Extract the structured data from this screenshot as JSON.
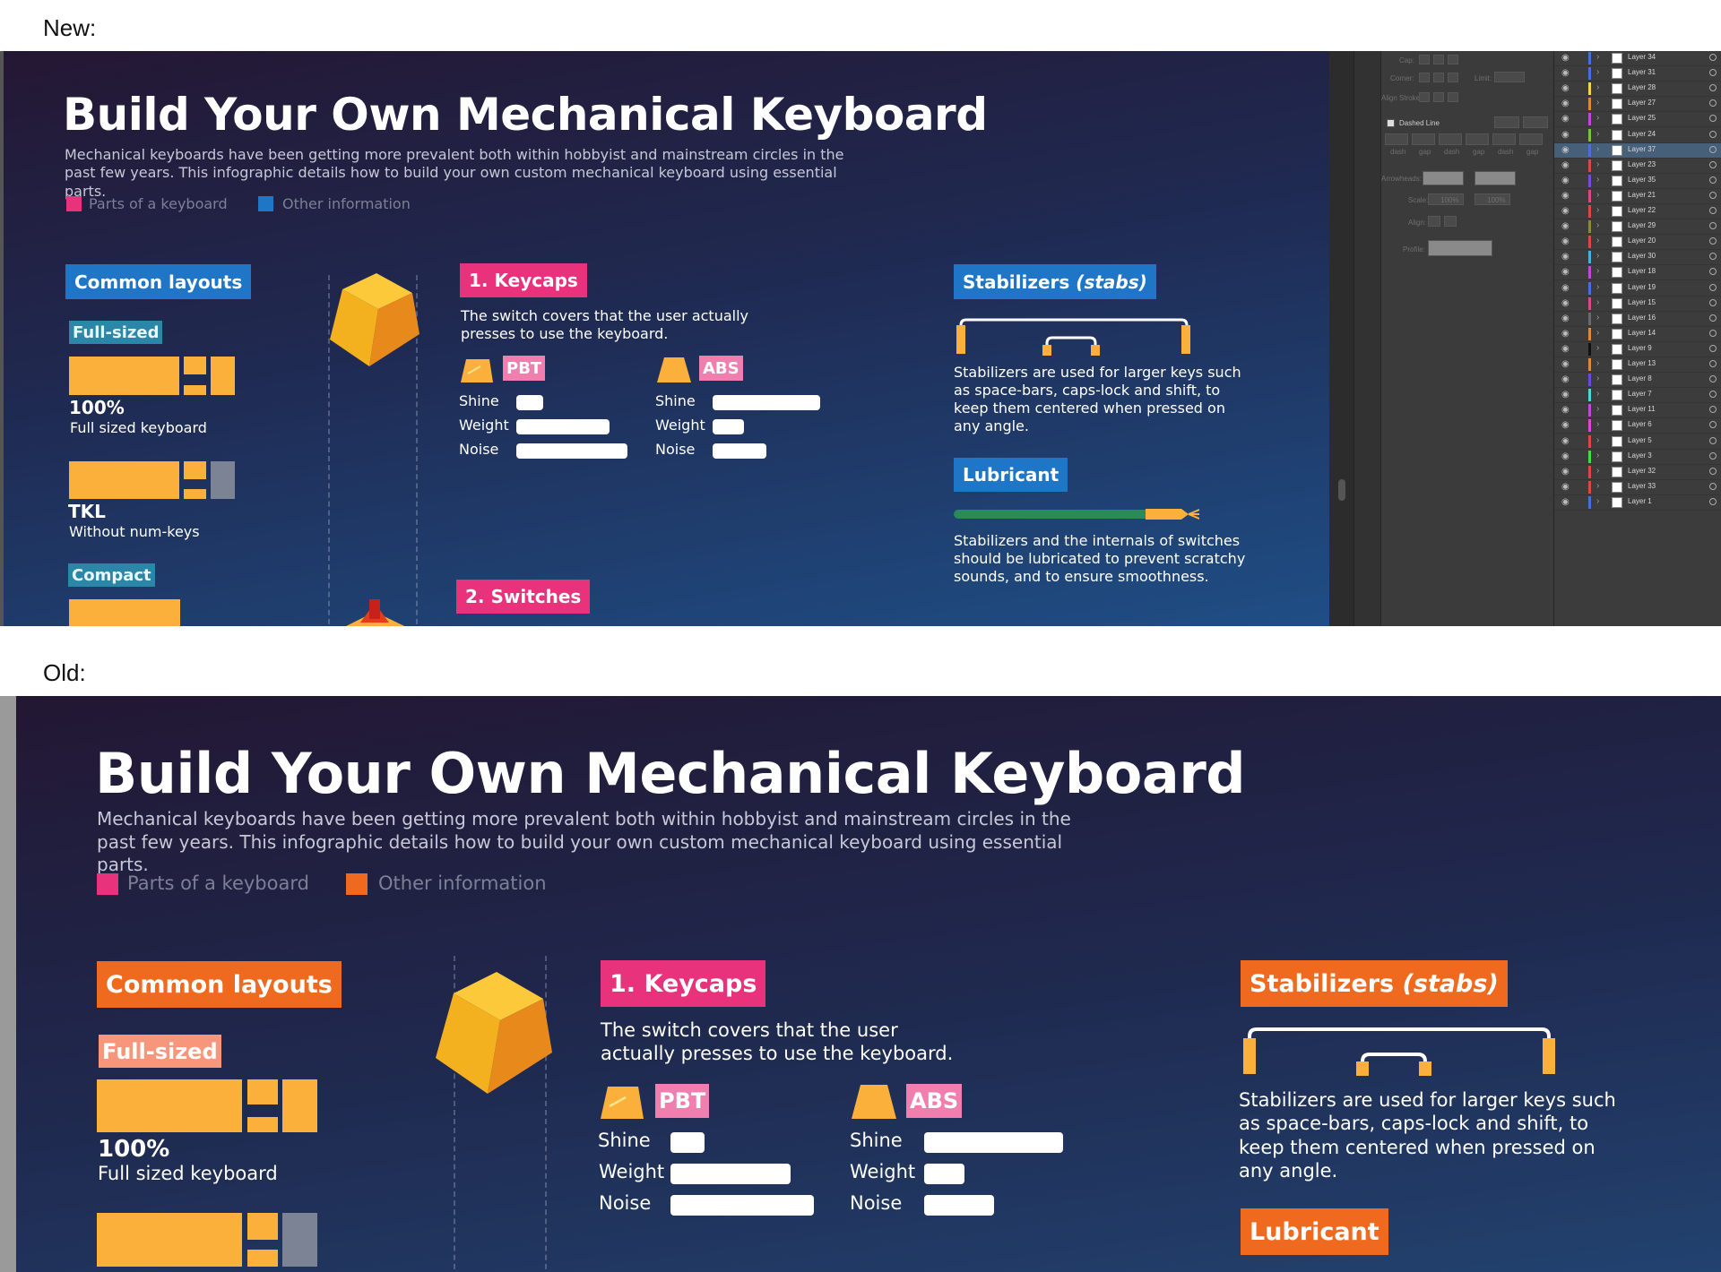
{
  "labels": {
    "new": "New:",
    "old": "Old:"
  },
  "colors": {
    "pink": "#e8337c",
    "blue": "#1f76c6",
    "orange": "#ef6a1f",
    "key_yellow": "#fbb03b",
    "gray_key": "#7b8394"
  },
  "new": {
    "title": "Build Your Own Mechanical Keyboard",
    "description": "Mechanical keyboards have been getting more prevalent both within hobbyist and mainstream circles in the past few years. This infographic details how to build your own custom mechanical keyboard using essential parts.",
    "legend": [
      {
        "label": "Parts of a keyboard",
        "color": "#e8337c"
      },
      {
        "label": "Other information",
        "color": "#1f76c6"
      }
    ],
    "common_layouts": "Common layouts",
    "full_sized_tag": "Full-sized",
    "full_pct": "100%",
    "full_desc": "Full sized keyboard",
    "tkl": "TKL",
    "tkl_desc": "Without num-keys",
    "compact_tag": "Compact",
    "keycaps_title": "1. Keycaps",
    "keycaps_desc": "The switch covers that the user actually presses to use the keyboard.",
    "pbt": "PBT",
    "abs": "ABS",
    "rating_labels": [
      "Shine",
      "Weight",
      "Noise"
    ],
    "pbt_ratings": [
      0.24,
      0.84,
      1.0
    ],
    "abs_ratings": [
      1.0,
      0.29,
      0.5
    ],
    "switches_title": "2. Switches",
    "stabilizers_title": "Stabilizers",
    "stabilizers_em": "(stabs)",
    "stabilizers_desc": "Stabilizers are used for larger keys such as space-bars, caps-lock and shift, to keep them centered when pressed on any angle.",
    "lubricant_title": "Lubricant",
    "lubricant_desc": "Stabilizers and the internals of switches should be lubricated to prevent scratchy sounds, and to ensure smoothness."
  },
  "old": {
    "title": "Build Your Own Mechanical Keyboard",
    "description": "Mechanical keyboards have been getting more prevalent both within hobbyist and mainstream circles in the past few years. This infographic details how to build your own custom mechanical keyboard using essential parts.",
    "legend": [
      {
        "label": "Parts of a keyboard",
        "color": "#e8337c"
      },
      {
        "label": "Other information",
        "color": "#ef6a1f"
      }
    ],
    "common_layouts": "Common layouts",
    "full_sized_tag": "Full-sized",
    "full_pct": "100%",
    "full_desc": "Full sized keyboard",
    "keycaps_title": "1. Keycaps",
    "keycaps_desc": "The switch covers that the user actually presses to use the keyboard.",
    "pbt": "PBT",
    "abs": "ABS",
    "rating_labels": [
      "Shine",
      "Weight",
      "Noise"
    ],
    "pbt_ratings": [
      0.24,
      0.84,
      1.0
    ],
    "abs_ratings": [
      1.0,
      0.29,
      0.5
    ],
    "stabilizers_title": "Stabilizers",
    "stabilizers_em": "(stabs)",
    "stabilizers_desc": "Stabilizers are used for larger keys such as space-bars, caps-lock and shift, to keep them centered when pressed on any angle.",
    "lubricant_title": "Lubricant"
  },
  "properties_panel": {
    "labels": [
      "Cap:",
      "Corner:",
      "Limit:",
      "Align Stroke:",
      "Dashed Line",
      "dash",
      "gap",
      "dash",
      "gap",
      "dash",
      "gap",
      "Arrowheads:",
      "Scale:",
      "100%",
      "100%",
      "Align:",
      "Profile:"
    ]
  },
  "layers": [
    {
      "name": "Layer 34",
      "color": "#4a6fd8"
    },
    {
      "name": "Layer 31",
      "color": "#4a6fd8"
    },
    {
      "name": "Layer 28",
      "color": "#f2d94a"
    },
    {
      "name": "Layer 27",
      "color": "#d98a3a"
    },
    {
      "name": "Layer 25",
      "color": "#c04ad8"
    },
    {
      "name": "Layer 24",
      "color": "#7ac23a"
    },
    {
      "name": "Layer 37",
      "color": "#4a6fd8",
      "selected": true
    },
    {
      "name": "Layer 23",
      "color": "#d84a4a"
    },
    {
      "name": "Layer 35",
      "color": "#7a4ad8"
    },
    {
      "name": "Layer 21",
      "color": "#d84a8a"
    },
    {
      "name": "Layer 22",
      "color": "#d84a4a"
    },
    {
      "name": "Layer 29",
      "color": "#8a8a3a"
    },
    {
      "name": "Layer 20",
      "color": "#d84a4a"
    },
    {
      "name": "Layer 30",
      "color": "#4ab2d8"
    },
    {
      "name": "Layer 18",
      "color": "#c04ad8"
    },
    {
      "name": "Layer 19",
      "color": "#4a6fd8"
    },
    {
      "name": "Layer 15",
      "color": "#d84a8a"
    },
    {
      "name": "Layer 16",
      "color": "#6a6a6a"
    },
    {
      "name": "Layer 14",
      "color": "#d98a3a"
    },
    {
      "name": "Layer 9",
      "color": "#111111"
    },
    {
      "name": "Layer 13",
      "color": "#d98a3a"
    },
    {
      "name": "Layer 8",
      "color": "#6a4ad8"
    },
    {
      "name": "Layer 7",
      "color": "#4ad8d8"
    },
    {
      "name": "Layer 11",
      "color": "#c04ad8"
    },
    {
      "name": "Layer 6",
      "color": "#d84ad8"
    },
    {
      "name": "Layer 5",
      "color": "#d84a4a"
    },
    {
      "name": "Layer 3",
      "color": "#4ad84a"
    },
    {
      "name": "Layer 32",
      "color": "#d84a4a"
    },
    {
      "name": "Layer 33",
      "color": "#d84a4a"
    },
    {
      "name": "Layer 1",
      "color": "#4a6fd8"
    }
  ]
}
